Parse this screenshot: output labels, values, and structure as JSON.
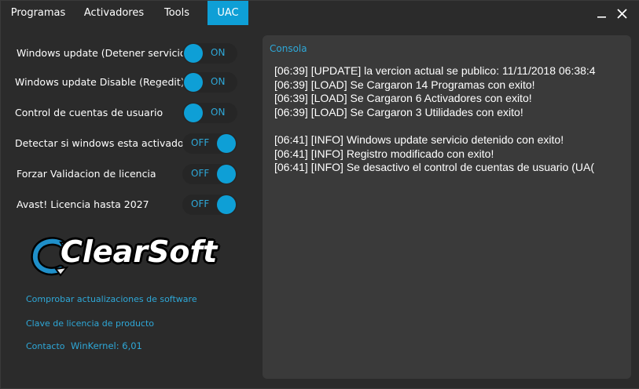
{
  "tabs": [
    {
      "label": "Programas",
      "active": false
    },
    {
      "label": "Activadores",
      "active": false
    },
    {
      "label": "Tools",
      "active": false
    },
    {
      "label": "UAC",
      "active": true
    }
  ],
  "window_buttons": {
    "minimize": "minimize-icon",
    "close": "close-icon"
  },
  "settings": [
    {
      "label": "Windows update (Detener servicio)",
      "state": "ON"
    },
    {
      "label": "Windows update Disable (Regedit)",
      "state": "ON"
    },
    {
      "label": "Control de cuentas de usuario",
      "state": "ON"
    },
    {
      "label": "Detectar si windows esta activado",
      "state": "OFF"
    },
    {
      "label": "Forzar Validacion de licencia",
      "state": "OFF"
    },
    {
      "label": "Avast! Licencia hasta 2027",
      "state": "OFF"
    }
  ],
  "logo": {
    "text": "ClearSoft"
  },
  "links": {
    "check_updates": "Comprobar actualizaciones de software",
    "license_key": "Clave de licencia de producto",
    "contact": "Contacto"
  },
  "version": "WinKernel: 6,01",
  "console": {
    "title": "Consola",
    "lines": [
      "[06:39] [UPDATE] la vercion actual se publico: 11/11/2018 06:38:4",
      "[06:39] [LOAD] Se Cargaron 14 Programas con exito!",
      "[06:39] [LOAD] Se Cargaron 6 Activadores con exito!",
      "[06:39] [LOAD] Se Cargaron 3 Utilidades con exito!",
      "",
      "[06:41] [INFO] Windows update servicio detenido con exito!",
      "[06:41] [INFO] Registro modificado con exito!",
      "[06:41] [INFO] Se desactivo el control de cuentas de usuario (UA("
    ]
  },
  "colors": {
    "accent": "#0e9fd6",
    "link": "#2ea8d8",
    "background": "#2b2b2b",
    "console_bg": "#3a3a3a"
  }
}
